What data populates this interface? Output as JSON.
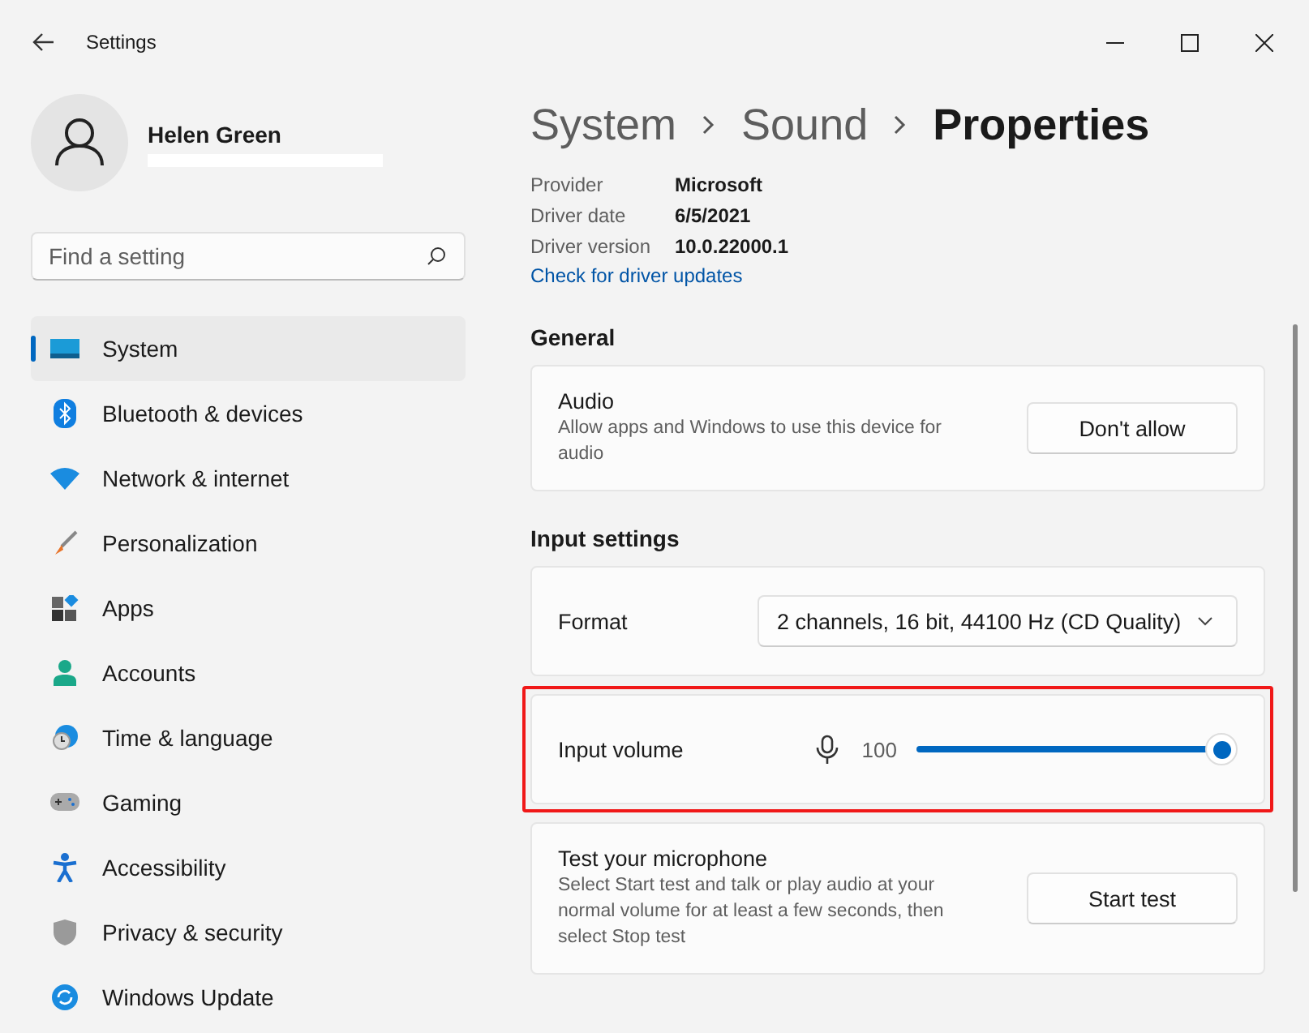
{
  "window": {
    "title": "Settings"
  },
  "user": {
    "name": "Helen Green"
  },
  "search": {
    "placeholder": "Find a setting"
  },
  "nav": [
    {
      "label": "System",
      "selected": true
    },
    {
      "label": "Bluetooth & devices",
      "selected": false
    },
    {
      "label": "Network & internet",
      "selected": false
    },
    {
      "label": "Personalization",
      "selected": false
    },
    {
      "label": "Apps",
      "selected": false
    },
    {
      "label": "Accounts",
      "selected": false
    },
    {
      "label": "Time & language",
      "selected": false
    },
    {
      "label": "Gaming",
      "selected": false
    },
    {
      "label": "Accessibility",
      "selected": false
    },
    {
      "label": "Privacy & security",
      "selected": false
    },
    {
      "label": "Windows Update",
      "selected": false
    }
  ],
  "breadcrumb": [
    "System",
    "Sound",
    "Properties"
  ],
  "driver_info": [
    {
      "label": "Provider",
      "value": "Microsoft"
    },
    {
      "label": "Driver date",
      "value": "6/5/2021"
    },
    {
      "label": "Driver version",
      "value": "10.0.22000.1"
    }
  ],
  "driver_link": "Check for driver updates",
  "sections": [
    {
      "heading": "General",
      "rows": [
        {
          "kind": "button",
          "title": "Audio",
          "description": "Allow apps and Windows to use this device for audio",
          "button": "Don't allow",
          "highlighted": false
        }
      ]
    },
    {
      "heading": "Input settings",
      "rows": [
        {
          "kind": "dropdown",
          "title": "Format",
          "value": "2 channels, 16 bit, 44100 Hz (CD Quality)",
          "highlighted": false
        },
        {
          "kind": "slider",
          "title": "Input volume",
          "reading": "100",
          "level": 1,
          "highlighted": true
        },
        {
          "kind": "button",
          "title": "Test your microphone",
          "description": "Select Start test and talk or play audio at your normal volume for at least a few seconds, then select Stop test",
          "button": "Start test",
          "highlighted": false
        }
      ]
    }
  ]
}
